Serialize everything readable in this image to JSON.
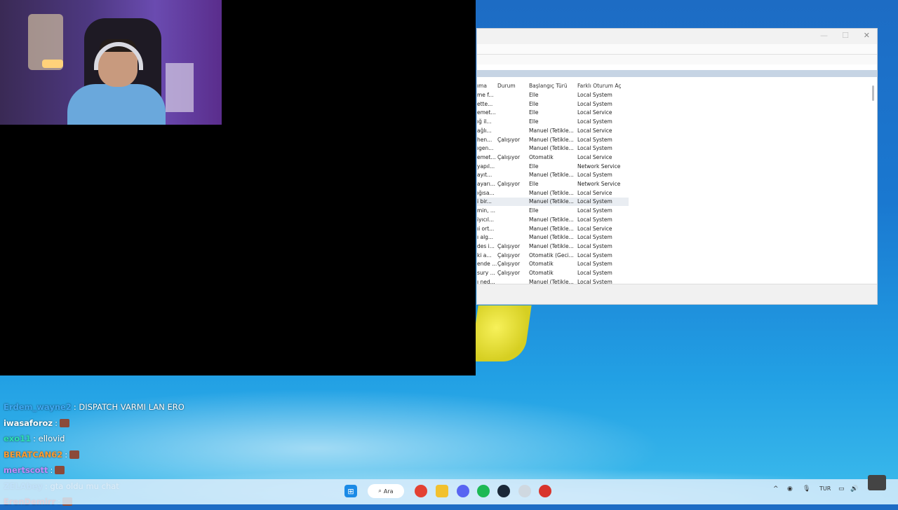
{
  "services_window": {
    "columns": [
      "ıma",
      "Durum",
      "Başlangıç Türü",
      "Farklı Oturum Aç"
    ],
    "rows": [
      {
        "name": "me f...",
        "status": "",
        "startup": "Elle",
        "logon": "Local System"
      },
      {
        "name": "ette...",
        "status": "",
        "startup": "Elle",
        "logon": "Local System"
      },
      {
        "name": "emet...",
        "status": "",
        "startup": "Elle",
        "logon": "Local Service"
      },
      {
        "name": "ığ il...",
        "status": "",
        "startup": "Elle",
        "logon": "Local System"
      },
      {
        "name": "ağlı...",
        "status": "",
        "startup": "Manuel (Tetikle...",
        "logon": "Local Service"
      },
      {
        "name": "hen...",
        "status": "Çalışıyor",
        "startup": "Manuel (Tetikle...",
        "logon": "Local System"
      },
      {
        "name": "ıgen...",
        "status": "",
        "startup": "Manuel (Tetikle...",
        "logon": "Local System"
      },
      {
        "name": "emet...",
        "status": "Çalışıyor",
        "startup": "Otomatik",
        "logon": "Local Service"
      },
      {
        "name": "yapıl...",
        "status": "",
        "startup": "Elle",
        "logon": "Network Service"
      },
      {
        "name": "ayıt...",
        "status": "",
        "startup": "Manuel (Tetikle...",
        "logon": "Local System"
      },
      {
        "name": "ayarı...",
        "status": "Çalışıyor",
        "startup": "Elle",
        "logon": "Network Service"
      },
      {
        "name": "ığısa...",
        "status": "",
        "startup": "Manuel (Tetikle...",
        "logon": "Local Service"
      },
      {
        "name": "i bir...",
        "status": "",
        "startup": "Manuel (Tetikle...",
        "logon": "Local System"
      },
      {
        "name": "min, ...",
        "status": "",
        "startup": "Elle",
        "logon": "Local System"
      },
      {
        "name": "iyıcıl...",
        "status": "",
        "startup": "Manuel (Tetikle...",
        "logon": "Local System"
      },
      {
        "name": "ıi ort...",
        "status": "",
        "startup": "Manuel (Tetikle...",
        "logon": "Local Service"
      },
      {
        "name": "ı alg...",
        "status": "",
        "startup": "Manuel (Tetikle...",
        "logon": "Local System"
      },
      {
        "name": "des i...",
        "status": "Çalışıyor",
        "startup": "Manuel (Tetikle...",
        "logon": "Local System"
      },
      {
        "name": "ki a...",
        "status": "Çalışıyor",
        "startup": "Otomatik (Geci...",
        "logon": "Local System"
      },
      {
        "name": "ende ...",
        "status": "Çalışıyor",
        "startup": "Otomatik",
        "logon": "Local System"
      },
      {
        "name": "sury ...",
        "status": "Çalışıyor",
        "startup": "Otomatik",
        "logon": "Local System"
      },
      {
        "name": "ı ned...",
        "status": "",
        "startup": "Manuel (Tetikle...",
        "logon": "Local System"
      }
    ],
    "selected_row": 12
  },
  "chat": [
    {
      "user": "Erdem_wayne2",
      "user_color": "#3fa9f5",
      "message": ": DISPATCH VARMI LAN ERO",
      "emote": false
    },
    {
      "user": "iwasaforoz",
      "user_color": "#ffffff",
      "message": ":",
      "emote": true
    },
    {
      "user": "exo11",
      "user_color": "#2ee0b0",
      "message": ": ellovid",
      "emote": false
    },
    {
      "user": "BERATCAN62",
      "user_color": "#ff9a2e",
      "message": ":",
      "emote": true
    },
    {
      "user": "mertscott",
      "user_color": "#c58cff",
      "message": ":",
      "emote": true
    },
    {
      "user": "ZELAbey",
      "user_color": "#3fa9f5",
      "message": ": gta oldu mu chat",
      "emote": false
    },
    {
      "user": "ErenDemirr",
      "user_color": "#ff3f3f",
      "message": ":",
      "emote": true
    }
  ],
  "taskbar": {
    "search_label": "Ara",
    "language": "TUR"
  }
}
